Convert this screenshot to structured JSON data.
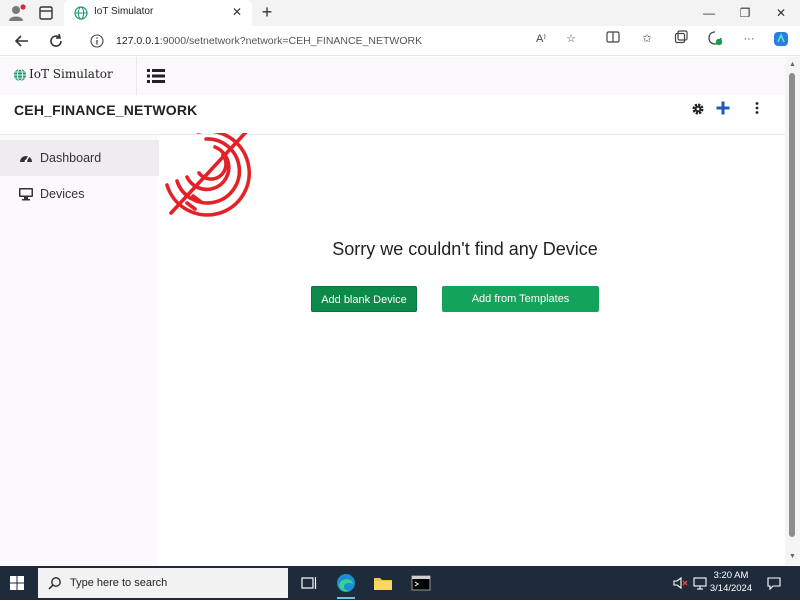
{
  "browser": {
    "tab_title": "IoT Simulator",
    "tab_close": "✕",
    "new_tab": "+",
    "address_host": "127.0.0.1",
    "address_rest": ":9000/setnetwork?network=CEH_FINANCE_NETWORK",
    "window_minimize": "—",
    "window_restore": "❐",
    "window_close": "✕"
  },
  "app": {
    "brand_name": "IoT Simulator",
    "network_name": "CEH_FINANCE_NETWORK"
  },
  "sidebar": {
    "items": [
      {
        "label": "Dashboard",
        "icon": "dashboard-gauge-icon",
        "active": true
      },
      {
        "label": "Devices",
        "icon": "monitor-icon",
        "active": false
      }
    ]
  },
  "main": {
    "empty_message": "Sorry we couldn't find any Device",
    "add_blank_label": "Add blank Device",
    "add_templates_label": "Add from Templates"
  },
  "taskbar": {
    "search_placeholder": "Type here to search",
    "time": "3:20 AM",
    "date": "3/14/2024"
  },
  "colors": {
    "accent_red": "#e32228",
    "button_green_dark": "#0b8a4a",
    "button_green": "#14a35a",
    "add_blue": "#1f5ab8"
  }
}
